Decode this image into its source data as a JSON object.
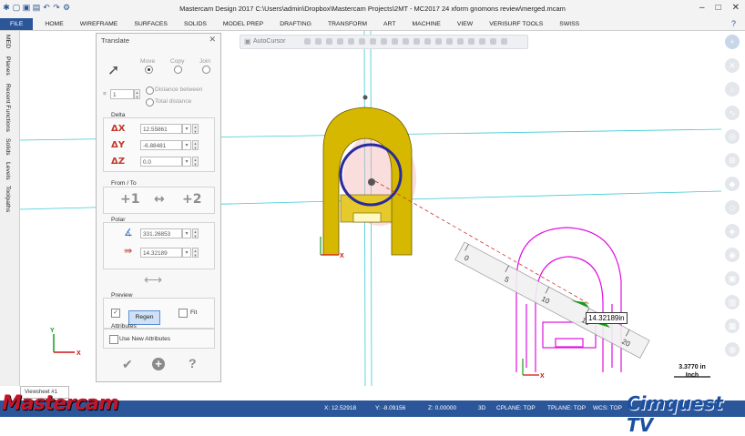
{
  "window": {
    "title": "Mastercam Design 2017  C:\\Users\\admin\\Dropbox\\Mastercam Projects\\2MT - MC2017 24 xform gnomons review\\merged.mcam",
    "minimize": "–",
    "maximize": "□",
    "close": "✕",
    "help": "?"
  },
  "ribbon": {
    "tabs": [
      "FILE",
      "HOME",
      "WIREFRAME",
      "SURFACES",
      "SOLIDS",
      "MODEL PREP",
      "DRAFTING",
      "TRANSFORM",
      "ART",
      "MACHINE",
      "VIEW",
      "VERISURF TOOLS",
      "SWISS"
    ]
  },
  "left_managers": [
    "MED",
    "Planes",
    "Recent Functions",
    "Solids",
    "Levels",
    "Toolpaths"
  ],
  "autocursor": {
    "label": "AutoCursor"
  },
  "panel": {
    "title": "Translate",
    "close": "✕",
    "mode": {
      "move": "Move",
      "copy": "Copy",
      "join": "Join",
      "selected": "move"
    },
    "instances": {
      "value": "1"
    },
    "distance": {
      "between": "Distance between",
      "total": "Total distance"
    },
    "delta": {
      "label": "Delta",
      "x_icon": "ΔX",
      "x": "12.55861",
      "y_icon": "ΔY",
      "y": "-6.88481",
      "z_icon": "ΔZ",
      "z": "0.0"
    },
    "from_to": {
      "label": "From / To",
      "from": "+1",
      "to": "+2",
      "arrow": "↔"
    },
    "polar": {
      "label": "Polar",
      "angle": "331.26853",
      "length": "14.32189"
    },
    "preview": {
      "label": "Preview",
      "regen": "Regen",
      "fit": "Fit",
      "regen_checked": "✓"
    },
    "attributes": {
      "label": "Attributes",
      "use_new": "Use New Attributes"
    },
    "footer": {
      "ok": "✔",
      "apply": "+",
      "help": "?"
    }
  },
  "viewport": {
    "readout": "14.32189in",
    "scale_value": "3.3770 in",
    "scale_unit": "Inch",
    "ruler_ticks": [
      "0",
      "5",
      "10",
      "15",
      "20"
    ],
    "gnomon_x": "X",
    "gnomon_y": "Y"
  },
  "sheet_tab": "Viewsheet #1",
  "status": {
    "x": "X:  12.52918",
    "y": "Y:  -8.09156",
    "z": "Z:  0.00000",
    "mode": "3D",
    "cplane": "CPLANE: TOP",
    "tplane": "TPLANE: TOP",
    "wcs": "WCS: TOP"
  },
  "branding": {
    "left": "Mastercam",
    "right": "Cimquest TV"
  },
  "colors": {
    "accent": "#2b579a",
    "part_yellow": "#d6b800",
    "part_magenta": "#e010e0",
    "circle": "#2a2a9c"
  }
}
